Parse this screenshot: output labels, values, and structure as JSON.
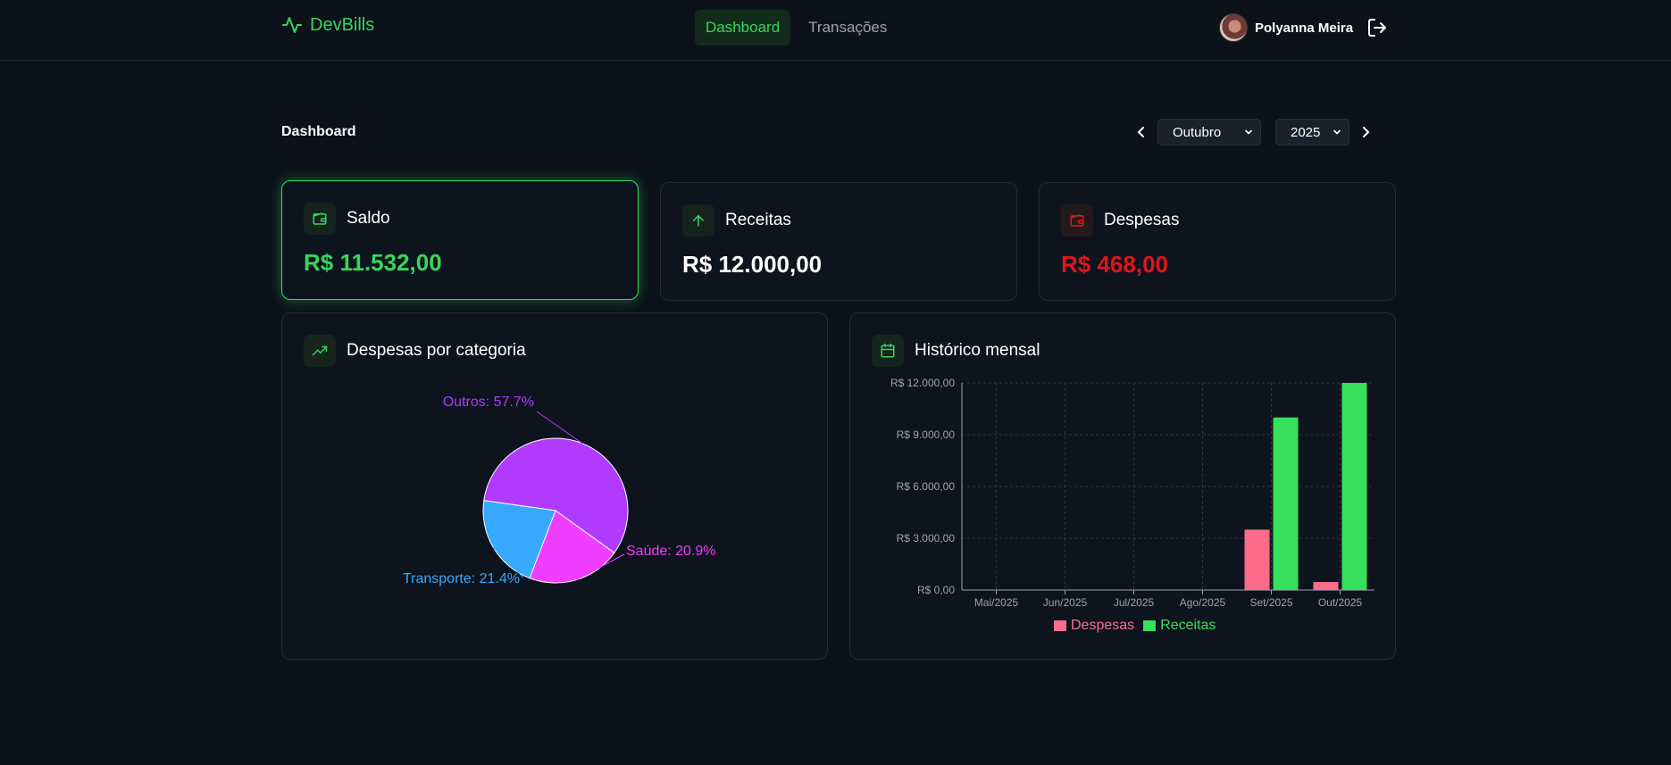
{
  "header": {
    "brand": "DevBills",
    "nav": [
      {
        "label": "Dashboard",
        "active": true
      },
      {
        "label": "Transações",
        "active": false
      }
    ],
    "user_name": "Polyanna Meira"
  },
  "page_title": "Dashboard",
  "period": {
    "month": "Outubro",
    "year": "2025"
  },
  "cards": {
    "saldo": {
      "label": "Saldo",
      "value": "R$ 11.532,00",
      "color": "#37d65c"
    },
    "receitas": {
      "label": "Receitas",
      "value": "R$ 12.000,00",
      "color": "#ffffff"
    },
    "despesas": {
      "label": "Despesas",
      "value": "R$ 468,00",
      "color": "#e0141f"
    }
  },
  "colors": {
    "accent": "#37d65c",
    "despesas": "#ff6b8b",
    "receitas": "#37e05c",
    "outros": "#b03aff",
    "saude": "#f03cff",
    "transporte": "#36a9ff"
  },
  "categories_panel": {
    "title": "Despesas por categoria",
    "chart_data": {
      "type": "pie",
      "slices": [
        {
          "label": "Outros",
          "value": 57.7,
          "text": "Outros: 57.7%",
          "color": "#b03aff"
        },
        {
          "label": "Saúde",
          "value": 20.9,
          "text": "Saúde: 20.9%",
          "color": "#f03cff"
        },
        {
          "label": "Transporte",
          "value": 21.4,
          "text": "Transporte: 21.4%",
          "color": "#36a9ff"
        }
      ]
    }
  },
  "history_panel": {
    "title": "Histórico mensal",
    "chart_data": {
      "type": "bar",
      "categories": [
        "Mai/2025",
        "Jun/2025",
        "Jul/2025",
        "Ago/2025",
        "Set/2025",
        "Out/2025"
      ],
      "series": [
        {
          "name": "Despesas",
          "values": [
            0,
            0,
            0,
            0,
            3500,
            468
          ],
          "color": "#ff6b8b"
        },
        {
          "name": "Receitas",
          "values": [
            0,
            0,
            0,
            0,
            10000,
            12000
          ],
          "color": "#37e05c"
        }
      ],
      "ylim": [
        0,
        12000
      ],
      "y_ticks": [
        0,
        3000,
        6000,
        9000,
        12000
      ],
      "y_tick_labels": [
        "R$ 0,00",
        "R$ 3.000,00",
        "R$ 6.000,00",
        "R$ 9.000,00",
        "R$ 12.000,00"
      ],
      "grid": true,
      "legend": "bottom"
    }
  }
}
